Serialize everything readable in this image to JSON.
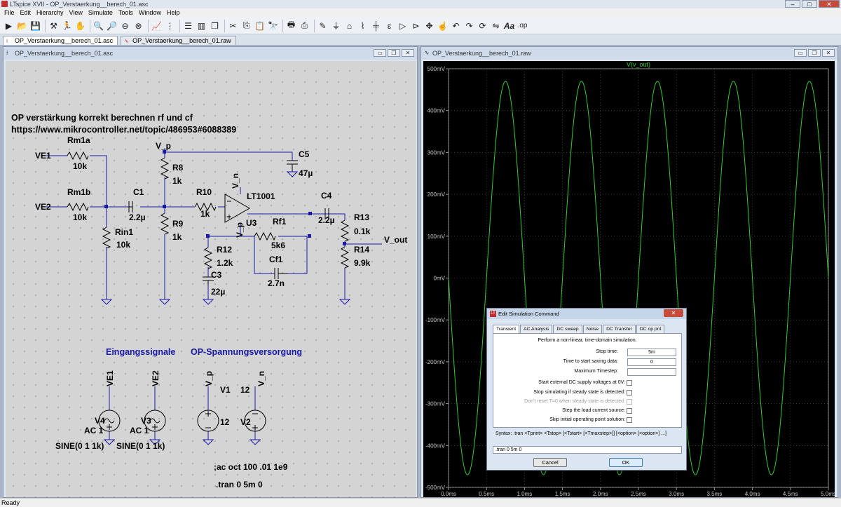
{
  "app": {
    "title": "LTspice XVII - OP_Verstaerkung__berech_01.asc"
  },
  "menu": [
    "File",
    "Edit",
    "Hierarchy",
    "View",
    "Simulate",
    "Tools",
    "Window",
    "Help"
  ],
  "toolbar": {
    "icons": [
      "run-icon",
      "open-icon",
      "save-icon",
      "control-panel-icon",
      "run-sim-icon",
      "halt-icon",
      "zoom-in-icon",
      "pan-icon",
      "zoom-out-icon",
      "zoom-fit-icon",
      "autorange-icon",
      "grid-icon",
      "tile-horizontal-icon",
      "tile-vertical-icon",
      "cascade-icon",
      "cut-icon",
      "copy-icon",
      "paste-icon",
      "find-icon",
      "print-setup-icon",
      "print-icon",
      "draw-wire-icon",
      "ground-icon",
      "label-net-icon",
      "resistor-icon",
      "capacitor-icon",
      "inductor-icon",
      "diode-icon",
      "component-icon",
      "move-icon",
      "drag-icon",
      "undo-icon",
      "redo-icon",
      "rotate-icon",
      "mirror-icon",
      "text-icon",
      "spice-directive-icon"
    ],
    "accent": "#2a5aa8"
  },
  "tabs": [
    {
      "label": "OP_Verstaerkung__berech_01.asc",
      "kind": "schematic",
      "active": true
    },
    {
      "label": "OP_Verstaerkung__berech_01.raw",
      "kind": "waveform",
      "active": false
    }
  ],
  "schematic": {
    "window_title": "OP_Verstaerkung__berech_01.asc",
    "comment_line1": "OP verstärkung korrekt berechnen rf und cf",
    "comment_line2": "https://www.mikrocontroller.net/topic/486953#6088389",
    "comment_color": "#1a1aa8",
    "labels": {
      "ve1": "VE1",
      "ve2": "VE2",
      "rm1a": "Rm1a",
      "rm1a_val": "10k",
      "rm1b": "Rm1b",
      "rm1b_val": "10k",
      "rin1": "Rin1",
      "rin1_val": "10k",
      "c1": "C1",
      "c1_val": "2.2µ",
      "vp": "V_p",
      "r8": "R8",
      "r8_val": "1k",
      "r9": "R9",
      "r9_val": "1k",
      "r10": "R10",
      "r10_val": "1k",
      "c5": "C5",
      "c5_val": "47µ",
      "vn_top": "V_n",
      "lt": "LT1001",
      "u3": "U3",
      "vp_bot": "V_p",
      "c4": "C4",
      "c4_val": "2.2µ",
      "r13": "R13",
      "r13_val": "0.1k",
      "r14": "R14",
      "r14_val": "9.9k",
      "vout": "V_out",
      "rf1": "Rf1",
      "rf1_val": "5k6",
      "cf1": "Cf1",
      "cf1_val": "2.7n",
      "r12": "R12",
      "r12_val": "1.2k",
      "c3": "C3",
      "c3_val": "22µ",
      "eing": "Eingangssignale",
      "opsp": "OP-Spannungsversorgung",
      "src_ve1": "VE1",
      "src_ve2": "VE2",
      "src_vp": "V_p",
      "src_vn": "V_n",
      "v1": "V1",
      "v1_val": "12",
      "v2": "V2",
      "v2_val": "12",
      "v4": "V4",
      "v4_ac": "AC 1",
      "v3": "V3",
      "v3_ac": "AC 1",
      "sine1": "SINE(0 1 1k)",
      "sine2": "SINE(0 1 1k)",
      "ac_cmd": ";ac oct 100 .01 1e9",
      "tran_cmd": ".tran 0 5m 0"
    },
    "wire_color": "#1a1aa8",
    "component_color": "#000000"
  },
  "waveform": {
    "window_title": "OP_Verstaerkung__berech_01.raw",
    "trace_name": "V(v_out)",
    "trace_color": "#33cc33",
    "grid_color": "#5a5a5a",
    "y_ticks": [
      "500mV",
      "400mV",
      "300mV",
      "200mV",
      "100mV",
      "0mV",
      "-100mV",
      "-200mV",
      "-300mV",
      "-400mV",
      "-500mV"
    ],
    "x_ticks": [
      "0.0ms",
      "0.5ms",
      "1.0ms",
      "1.5ms",
      "2.0ms",
      "2.5ms",
      "3.0ms",
      "3.5ms",
      "4.0ms",
      "4.5ms",
      "5.0ms"
    ]
  },
  "chart_data": {
    "type": "line",
    "title": "V(v_out)",
    "xlabel": "",
    "ylabel": "",
    "xlim": [
      0,
      5
    ],
    "ylim": [
      -500,
      500
    ],
    "grid": true,
    "series": [
      {
        "name": "V(v_out)",
        "amplitude_mV": 500,
        "frequency_kHz": 1,
        "phase": "sine"
      }
    ]
  },
  "dialog": {
    "title": "Edit Simulation Command",
    "tabs": [
      "Transient",
      "AC Analysis",
      "DC sweep",
      "Noise",
      "DC Transfer",
      "DC op pnt"
    ],
    "description": "Perform a non-linear, time-domain simulation.",
    "fields": [
      {
        "label": "Stop time:",
        "value": "5m"
      },
      {
        "label": "Time to start saving data:",
        "value": "0"
      },
      {
        "label": "Maximum Timestep:",
        "value": ""
      }
    ],
    "checks": [
      {
        "label": "Start external DC supply voltages at 0V:",
        "disabled": false
      },
      {
        "label": "Stop simulating if steady state is detected:",
        "disabled": false
      },
      {
        "label": "Don't reset T=0 when steady state is detected:",
        "disabled": true
      },
      {
        "label": "Step the load current source:",
        "disabled": false
      },
      {
        "label": "Skip initial operating point solution:",
        "disabled": false
      }
    ],
    "syntax": "Syntax:  .tran <Tprint> <Tstop> [<Tstart> [<Tmaxstep>]] [<option> [<option>] ...]",
    "command": ".tran 0 5m 0",
    "cancel": "Cancel",
    "ok": "OK"
  },
  "status": "Ready"
}
